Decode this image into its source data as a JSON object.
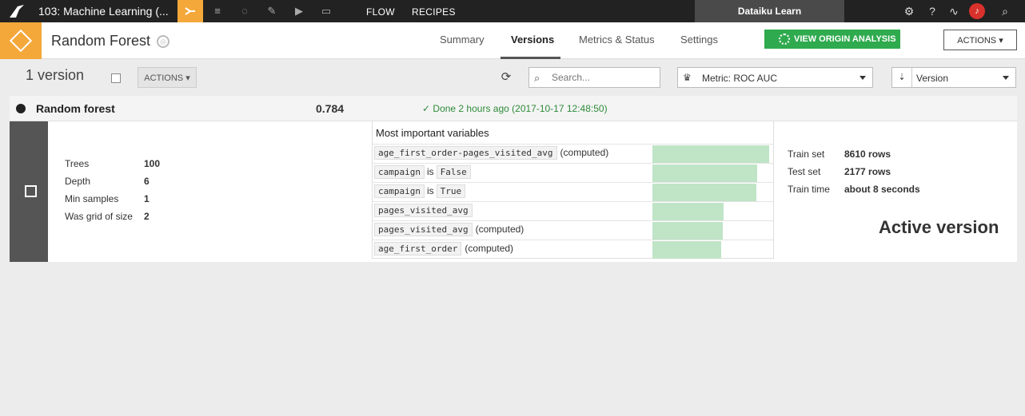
{
  "nav": {
    "project_title": "103: Machine Learning (...",
    "flow": "FLOW",
    "recipes": "RECIPES",
    "instance": "Dataiku Learn",
    "accent": "#f4a83a"
  },
  "header": {
    "model_title": "Random Forest",
    "tabs": [
      "Summary",
      "Versions",
      "Metrics & Status",
      "Settings"
    ],
    "active_tab": "Versions",
    "view_origin": "VIEW ORIGIN ANALYSIS",
    "actions": "ACTIONS"
  },
  "toolbar": {
    "count": "1 version",
    "actions": "ACTIONS",
    "search_placeholder": "Search...",
    "metric": "Metric: ROC AUC",
    "sort": "Version"
  },
  "version": {
    "name": "Random forest",
    "score": "0.784",
    "status": "Done 2 hours ago (2017-10-17 12:48:50)",
    "params": [
      {
        "k": "Trees",
        "v": "100"
      },
      {
        "k": "Depth",
        "v": "6"
      },
      {
        "k": "Min samples",
        "v": "1"
      },
      {
        "k": "Was grid of size",
        "v": "2"
      }
    ],
    "vars_title": "Most important variables",
    "variables": [
      {
        "code": "age_first_order-pages_visited_avg",
        "is": "",
        "val": "",
        "suffix": "(computed)",
        "importance": 1.0
      },
      {
        "code": "campaign",
        "is": "is",
        "val": "False",
        "suffix": "",
        "importance": 0.9
      },
      {
        "code": "campaign",
        "is": "is",
        "val": "True",
        "suffix": "",
        "importance": 0.89
      },
      {
        "code": "pages_visited_avg",
        "is": "",
        "val": "",
        "suffix": "",
        "importance": 0.61
      },
      {
        "code": "pages_visited_avg",
        "is": "",
        "val": "",
        "suffix": "(computed)",
        "importance": 0.6
      },
      {
        "code": "age_first_order",
        "is": "",
        "val": "",
        "suffix": "(computed)",
        "importance": 0.59
      }
    ],
    "stats": [
      {
        "k": "Train set",
        "v": "8610 rows"
      },
      {
        "k": "Test set",
        "v": "2177 rows"
      },
      {
        "k": "Train time",
        "v": "about 8 seconds"
      }
    ],
    "active_label": "Active version"
  }
}
